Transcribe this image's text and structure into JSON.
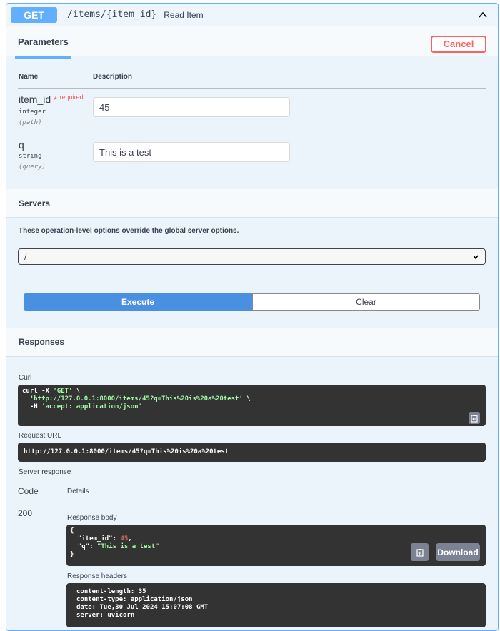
{
  "summary": {
    "method": "GET",
    "path": "/items/{item_id}",
    "description": "Read Item"
  },
  "parameters": {
    "tab_label": "Parameters",
    "cancel_label": "Cancel",
    "col_name": "Name",
    "col_description": "Description",
    "items": [
      {
        "name": "item_id",
        "required_star": "*",
        "required_label": "required",
        "type": "integer",
        "in": "(path)",
        "value": "45"
      },
      {
        "name": "q",
        "type": "string",
        "in": "(query)",
        "value": "This is a test"
      }
    ]
  },
  "servers": {
    "title": "Servers",
    "note": "These operation-level options override the global server options.",
    "selected": "/"
  },
  "actions": {
    "execute_label": "Execute",
    "clear_label": "Clear"
  },
  "responses": {
    "title": "Responses",
    "curl_label": "Curl",
    "curl": {
      "line1_cmd": "curl -X ",
      "line1_method": "'GET'",
      "line1_end": " \\",
      "line2_url": "'http://127.0.0.1:8000/items/45?q=This%20is%20a%20test'",
      "line2_end": " \\",
      "line3_flag": "  -H ",
      "line3_header": "'accept: application/json'"
    },
    "request_url_label": "Request URL",
    "request_url": "http://127.0.0.1:8000/items/45?q=This%20is%20a%20test",
    "server_response_label": "Server response",
    "col_code": "Code",
    "col_details": "Details",
    "code": "200",
    "response_body_label": "Response body",
    "body": {
      "open": "{",
      "key1": "  \"item_id\": ",
      "val1": "45",
      "comma1": ",",
      "key2": "  \"q\": ",
      "val2": "\"This is a test\"",
      "close": "}"
    },
    "download_label": "Download",
    "response_headers_label": "Response headers",
    "headers": [
      "content-length: 35",
      "content-type: application/json",
      "date: Tue,30 Jul 2024 15:07:08 GMT",
      "server: uvicorn"
    ]
  },
  "colors": {
    "get": "#61affe",
    "execute": "#4990e2",
    "cancel": "#ff6060",
    "code_bg": "#333333"
  }
}
